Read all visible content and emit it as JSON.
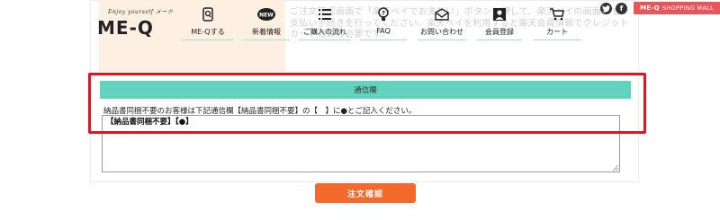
{
  "brand": {
    "tagline": "Enjoy yourself メーク",
    "logo_text": "ME-Q"
  },
  "nav": {
    "items": [
      {
        "label": "ME-Qする",
        "icon": "phone-q-icon"
      },
      {
        "label": "新着情報",
        "icon": "new-badge-icon"
      },
      {
        "label": "ご購入の流れ",
        "icon": "list-icon"
      },
      {
        "label": "FAQ",
        "icon": "question-bulb-icon"
      },
      {
        "label": "お問い合わせ",
        "icon": "mail-icon"
      },
      {
        "label": "会員登録",
        "icon": "user-icon"
      },
      {
        "label": "カート",
        "icon": "cart-icon"
      }
    ]
  },
  "social": {
    "twitter": "twitter-icon",
    "facebook": "facebook-icon"
  },
  "mall": {
    "brand": "ME-Q",
    "label": "SHOPPING MALL"
  },
  "background_text": "ご注文確認画面で「楽天ペイでお支払い」ボタンを押して、楽天ペイの画面にてお支払い手続きを行ってください。楽天ペイを利用すると楽天会員情報でクレジットカード登録の必要です。",
  "remarks": {
    "header": "通信欄",
    "instruction": "納品書同梱不要のお客様は下記通信欄【納品書同梱不要】の【　】に●とご記入ください。",
    "textarea_value": "【納品書同梱不要】【●】"
  },
  "confirm_button": "注文確認",
  "colors": {
    "accent_teal": "#63d3c0",
    "button_orange": "#f46a2d",
    "highlight_red": "#e0161c",
    "mall_red": "#e8555a"
  }
}
